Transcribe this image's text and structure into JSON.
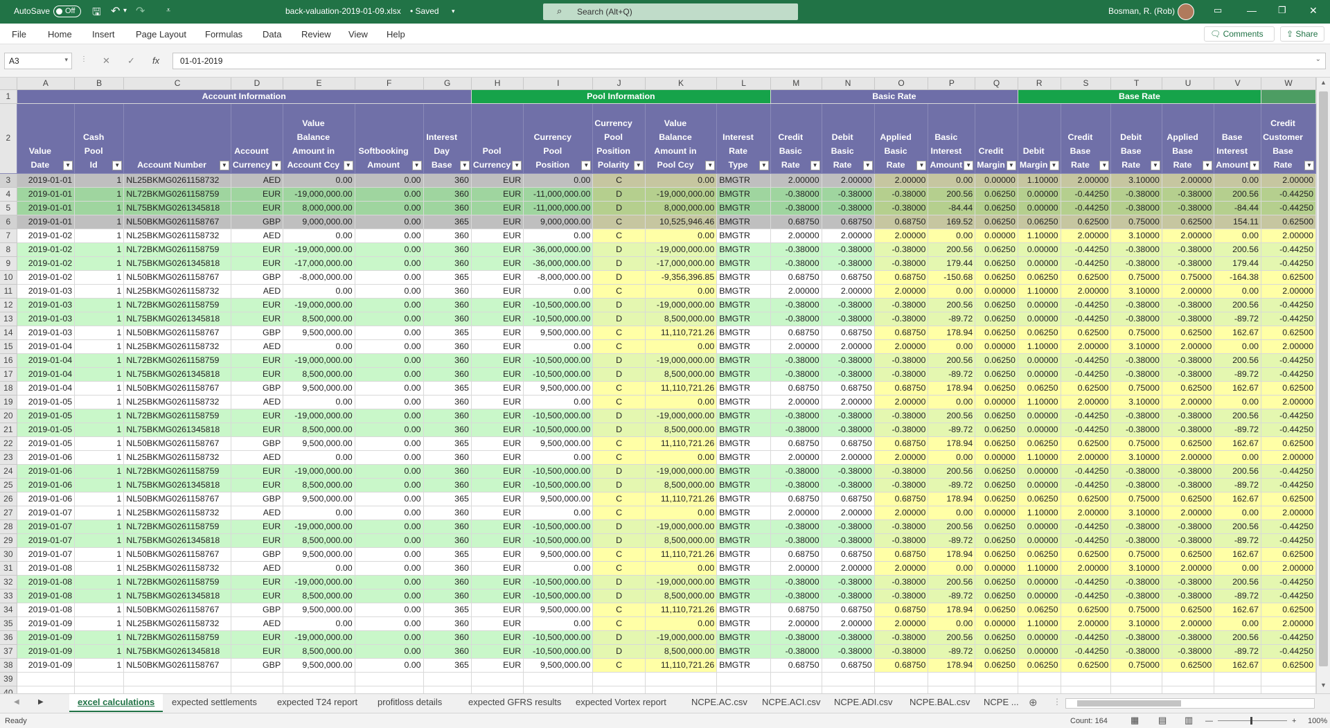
{
  "titlebar": {
    "autosave_label": "AutoSave",
    "autosave_state": "Off",
    "filename": "back-valuation-2019-01-09.xlsx",
    "saved_state": "• Saved",
    "search_placeholder": "Search (Alt+Q)",
    "user_name": "Bosman, R. (Rob)"
  },
  "menu": {
    "file": "File",
    "home": "Home",
    "insert": "Insert",
    "page_layout": "Page Layout",
    "formulas": "Formulas",
    "data": "Data",
    "review": "Review",
    "view": "View",
    "help": "Help",
    "comments": "Comments",
    "share": "Share"
  },
  "formula_bar": {
    "name_box": "A3",
    "fx": "fx",
    "value": "01-01-2019"
  },
  "columns": [
    "A",
    "B",
    "C",
    "D",
    "E",
    "F",
    "G",
    "H",
    "I",
    "J",
    "K",
    "L",
    "M",
    "N",
    "O",
    "P",
    "Q",
    "R",
    "S",
    "T",
    "U",
    "V",
    "W"
  ],
  "sections": [
    "Account Information",
    "Pool Information",
    "Basic Rate",
    "Base Rate"
  ],
  "headers": [
    "Value Date",
    "Cash Pool\nId",
    "Account Number",
    "Account\nCurrency",
    "Value Balance\nAmount in\nAccount Ccy",
    "Softbooking\nAmount",
    "Interest\nDay Base",
    "Pool\nCurrency",
    "Currency\nPool Position",
    "Currency\nPool\nPosition\nPolarity",
    "Value Balance\nAmount in\nPool Ccy",
    "Interest\nRate Type",
    "Credit\nBasic Rate",
    "Debit\nBasic Rate",
    "Applied\nBasic Rate",
    "Basic\nInterest\nAmount",
    "Credit\nMargin",
    "Debit\nMargin",
    "Credit\nBase Rate",
    "Debit\nBase Rate",
    "Applied\nBase Rate",
    "Base\nInterest\nAmount",
    "Credit\nCustomer\nBase Rate"
  ],
  "rows": [
    [
      "2019-01-01",
      "1",
      "NL25BKMG0261158732",
      "AED",
      "0.00",
      "0.00",
      "360",
      "EUR",
      "0.00",
      "C",
      "0.00",
      "BMGTR",
      "2.00000",
      "2.00000",
      "2.00000",
      "0.00",
      "0.00000",
      "1.10000",
      "2.00000",
      "3.10000",
      "2.00000",
      "0.00",
      "2.00000"
    ],
    [
      "2019-01-01",
      "1",
      "NL72BKMG0261158759",
      "EUR",
      "-19,000,000.00",
      "0.00",
      "360",
      "EUR",
      "-11,000,000.00",
      "D",
      "-19,000,000.00",
      "BMGTR",
      "-0.38000",
      "-0.38000",
      "-0.38000",
      "200.56",
      "0.06250",
      "0.00000",
      "-0.44250",
      "-0.38000",
      "-0.38000",
      "200.56",
      "-0.44250"
    ],
    [
      "2019-01-01",
      "1",
      "NL75BKMG0261345818",
      "EUR",
      "8,000,000.00",
      "0.00",
      "360",
      "EUR",
      "-11,000,000.00",
      "D",
      "8,000,000.00",
      "BMGTR",
      "-0.38000",
      "-0.38000",
      "-0.38000",
      "-84.44",
      "0.06250",
      "0.00000",
      "-0.44250",
      "-0.38000",
      "-0.38000",
      "-84.44",
      "-0.44250"
    ],
    [
      "2019-01-01",
      "1",
      "NL50BKMG0261158767",
      "GBP",
      "9,000,000.00",
      "0.00",
      "365",
      "EUR",
      "9,000,000.00",
      "C",
      "10,525,946.46",
      "BMGTR",
      "0.68750",
      "0.68750",
      "0.68750",
      "169.52",
      "0.06250",
      "0.06250",
      "0.62500",
      "0.75000",
      "0.62500",
      "154.11",
      "0.62500"
    ],
    [
      "2019-01-02",
      "1",
      "NL25BKMG0261158732",
      "AED",
      "0.00",
      "0.00",
      "360",
      "EUR",
      "0.00",
      "C",
      "0.00",
      "BMGTR",
      "2.00000",
      "2.00000",
      "2.00000",
      "0.00",
      "0.00000",
      "1.10000",
      "2.00000",
      "3.10000",
      "2.00000",
      "0.00",
      "2.00000"
    ],
    [
      "2019-01-02",
      "1",
      "NL72BKMG0261158759",
      "EUR",
      "-19,000,000.00",
      "0.00",
      "360",
      "EUR",
      "-36,000,000.00",
      "D",
      "-19,000,000.00",
      "BMGTR",
      "-0.38000",
      "-0.38000",
      "-0.38000",
      "200.56",
      "0.06250",
      "0.00000",
      "-0.44250",
      "-0.38000",
      "-0.38000",
      "200.56",
      "-0.44250"
    ],
    [
      "2019-01-02",
      "1",
      "NL75BKMG0261345818",
      "EUR",
      "-17,000,000.00",
      "0.00",
      "360",
      "EUR",
      "-36,000,000.00",
      "D",
      "-17,000,000.00",
      "BMGTR",
      "-0.38000",
      "-0.38000",
      "-0.38000",
      "179.44",
      "0.06250",
      "0.00000",
      "-0.44250",
      "-0.38000",
      "-0.38000",
      "179.44",
      "-0.44250"
    ],
    [
      "2019-01-02",
      "1",
      "NL50BKMG0261158767",
      "GBP",
      "-8,000,000.00",
      "0.00",
      "365",
      "EUR",
      "-8,000,000.00",
      "D",
      "-9,356,396.85",
      "BMGTR",
      "0.68750",
      "0.68750",
      "0.68750",
      "-150.68",
      "0.06250",
      "0.06250",
      "0.62500",
      "0.75000",
      "0.75000",
      "-164.38",
      "0.62500"
    ],
    [
      "2019-01-03",
      "1",
      "NL25BKMG0261158732",
      "AED",
      "0.00",
      "0.00",
      "360",
      "EUR",
      "0.00",
      "C",
      "0.00",
      "BMGTR",
      "2.00000",
      "2.00000",
      "2.00000",
      "0.00",
      "0.00000",
      "1.10000",
      "2.00000",
      "3.10000",
      "2.00000",
      "0.00",
      "2.00000"
    ],
    [
      "2019-01-03",
      "1",
      "NL72BKMG0261158759",
      "EUR",
      "-19,000,000.00",
      "0.00",
      "360",
      "EUR",
      "-10,500,000.00",
      "D",
      "-19,000,000.00",
      "BMGTR",
      "-0.38000",
      "-0.38000",
      "-0.38000",
      "200.56",
      "0.06250",
      "0.00000",
      "-0.44250",
      "-0.38000",
      "-0.38000",
      "200.56",
      "-0.44250"
    ],
    [
      "2019-01-03",
      "1",
      "NL75BKMG0261345818",
      "EUR",
      "8,500,000.00",
      "0.00",
      "360",
      "EUR",
      "-10,500,000.00",
      "D",
      "8,500,000.00",
      "BMGTR",
      "-0.38000",
      "-0.38000",
      "-0.38000",
      "-89.72",
      "0.06250",
      "0.00000",
      "-0.44250",
      "-0.38000",
      "-0.38000",
      "-89.72",
      "-0.44250"
    ],
    [
      "2019-01-03",
      "1",
      "NL50BKMG0261158767",
      "GBP",
      "9,500,000.00",
      "0.00",
      "365",
      "EUR",
      "9,500,000.00",
      "C",
      "11,110,721.26",
      "BMGTR",
      "0.68750",
      "0.68750",
      "0.68750",
      "178.94",
      "0.06250",
      "0.06250",
      "0.62500",
      "0.75000",
      "0.62500",
      "162.67",
      "0.62500"
    ],
    [
      "2019-01-04",
      "1",
      "NL25BKMG0261158732",
      "AED",
      "0.00",
      "0.00",
      "360",
      "EUR",
      "0.00",
      "C",
      "0.00",
      "BMGTR",
      "2.00000",
      "2.00000",
      "2.00000",
      "0.00",
      "0.00000",
      "1.10000",
      "2.00000",
      "3.10000",
      "2.00000",
      "0.00",
      "2.00000"
    ],
    [
      "2019-01-04",
      "1",
      "NL72BKMG0261158759",
      "EUR",
      "-19,000,000.00",
      "0.00",
      "360",
      "EUR",
      "-10,500,000.00",
      "D",
      "-19,000,000.00",
      "BMGTR",
      "-0.38000",
      "-0.38000",
      "-0.38000",
      "200.56",
      "0.06250",
      "0.00000",
      "-0.44250",
      "-0.38000",
      "-0.38000",
      "200.56",
      "-0.44250"
    ],
    [
      "2019-01-04",
      "1",
      "NL75BKMG0261345818",
      "EUR",
      "8,500,000.00",
      "0.00",
      "360",
      "EUR",
      "-10,500,000.00",
      "D",
      "8,500,000.00",
      "BMGTR",
      "-0.38000",
      "-0.38000",
      "-0.38000",
      "-89.72",
      "0.06250",
      "0.00000",
      "-0.44250",
      "-0.38000",
      "-0.38000",
      "-89.72",
      "-0.44250"
    ],
    [
      "2019-01-04",
      "1",
      "NL50BKMG0261158767",
      "GBP",
      "9,500,000.00",
      "0.00",
      "365",
      "EUR",
      "9,500,000.00",
      "C",
      "11,110,721.26",
      "BMGTR",
      "0.68750",
      "0.68750",
      "0.68750",
      "178.94",
      "0.06250",
      "0.06250",
      "0.62500",
      "0.75000",
      "0.62500",
      "162.67",
      "0.62500"
    ],
    [
      "2019-01-05",
      "1",
      "NL25BKMG0261158732",
      "AED",
      "0.00",
      "0.00",
      "360",
      "EUR",
      "0.00",
      "C",
      "0.00",
      "BMGTR",
      "2.00000",
      "2.00000",
      "2.00000",
      "0.00",
      "0.00000",
      "1.10000",
      "2.00000",
      "3.10000",
      "2.00000",
      "0.00",
      "2.00000"
    ],
    [
      "2019-01-05",
      "1",
      "NL72BKMG0261158759",
      "EUR",
      "-19,000,000.00",
      "0.00",
      "360",
      "EUR",
      "-10,500,000.00",
      "D",
      "-19,000,000.00",
      "BMGTR",
      "-0.38000",
      "-0.38000",
      "-0.38000",
      "200.56",
      "0.06250",
      "0.00000",
      "-0.44250",
      "-0.38000",
      "-0.38000",
      "200.56",
      "-0.44250"
    ],
    [
      "2019-01-05",
      "1",
      "NL75BKMG0261345818",
      "EUR",
      "8,500,000.00",
      "0.00",
      "360",
      "EUR",
      "-10,500,000.00",
      "D",
      "8,500,000.00",
      "BMGTR",
      "-0.38000",
      "-0.38000",
      "-0.38000",
      "-89.72",
      "0.06250",
      "0.00000",
      "-0.44250",
      "-0.38000",
      "-0.38000",
      "-89.72",
      "-0.44250"
    ],
    [
      "2019-01-05",
      "1",
      "NL50BKMG0261158767",
      "GBP",
      "9,500,000.00",
      "0.00",
      "365",
      "EUR",
      "9,500,000.00",
      "C",
      "11,110,721.26",
      "BMGTR",
      "0.68750",
      "0.68750",
      "0.68750",
      "178.94",
      "0.06250",
      "0.06250",
      "0.62500",
      "0.75000",
      "0.62500",
      "162.67",
      "0.62500"
    ],
    [
      "2019-01-06",
      "1",
      "NL25BKMG0261158732",
      "AED",
      "0.00",
      "0.00",
      "360",
      "EUR",
      "0.00",
      "C",
      "0.00",
      "BMGTR",
      "2.00000",
      "2.00000",
      "2.00000",
      "0.00",
      "0.00000",
      "1.10000",
      "2.00000",
      "3.10000",
      "2.00000",
      "0.00",
      "2.00000"
    ],
    [
      "2019-01-06",
      "1",
      "NL72BKMG0261158759",
      "EUR",
      "-19,000,000.00",
      "0.00",
      "360",
      "EUR",
      "-10,500,000.00",
      "D",
      "-19,000,000.00",
      "BMGTR",
      "-0.38000",
      "-0.38000",
      "-0.38000",
      "200.56",
      "0.06250",
      "0.00000",
      "-0.44250",
      "-0.38000",
      "-0.38000",
      "200.56",
      "-0.44250"
    ],
    [
      "2019-01-06",
      "1",
      "NL75BKMG0261345818",
      "EUR",
      "8,500,000.00",
      "0.00",
      "360",
      "EUR",
      "-10,500,000.00",
      "D",
      "8,500,000.00",
      "BMGTR",
      "-0.38000",
      "-0.38000",
      "-0.38000",
      "-89.72",
      "0.06250",
      "0.00000",
      "-0.44250",
      "-0.38000",
      "-0.38000",
      "-89.72",
      "-0.44250"
    ],
    [
      "2019-01-06",
      "1",
      "NL50BKMG0261158767",
      "GBP",
      "9,500,000.00",
      "0.00",
      "365",
      "EUR",
      "9,500,000.00",
      "C",
      "11,110,721.26",
      "BMGTR",
      "0.68750",
      "0.68750",
      "0.68750",
      "178.94",
      "0.06250",
      "0.06250",
      "0.62500",
      "0.75000",
      "0.62500",
      "162.67",
      "0.62500"
    ],
    [
      "2019-01-07",
      "1",
      "NL25BKMG0261158732",
      "AED",
      "0.00",
      "0.00",
      "360",
      "EUR",
      "0.00",
      "C",
      "0.00",
      "BMGTR",
      "2.00000",
      "2.00000",
      "2.00000",
      "0.00",
      "0.00000",
      "1.10000",
      "2.00000",
      "3.10000",
      "2.00000",
      "0.00",
      "2.00000"
    ],
    [
      "2019-01-07",
      "1",
      "NL72BKMG0261158759",
      "EUR",
      "-19,000,000.00",
      "0.00",
      "360",
      "EUR",
      "-10,500,000.00",
      "D",
      "-19,000,000.00",
      "BMGTR",
      "-0.38000",
      "-0.38000",
      "-0.38000",
      "200.56",
      "0.06250",
      "0.00000",
      "-0.44250",
      "-0.38000",
      "-0.38000",
      "200.56",
      "-0.44250"
    ],
    [
      "2019-01-07",
      "1",
      "NL75BKMG0261345818",
      "EUR",
      "8,500,000.00",
      "0.00",
      "360",
      "EUR",
      "-10,500,000.00",
      "D",
      "8,500,000.00",
      "BMGTR",
      "-0.38000",
      "-0.38000",
      "-0.38000",
      "-89.72",
      "0.06250",
      "0.00000",
      "-0.44250",
      "-0.38000",
      "-0.38000",
      "-89.72",
      "-0.44250"
    ],
    [
      "2019-01-07",
      "1",
      "NL50BKMG0261158767",
      "GBP",
      "9,500,000.00",
      "0.00",
      "365",
      "EUR",
      "9,500,000.00",
      "C",
      "11,110,721.26",
      "BMGTR",
      "0.68750",
      "0.68750",
      "0.68750",
      "178.94",
      "0.06250",
      "0.06250",
      "0.62500",
      "0.75000",
      "0.62500",
      "162.67",
      "0.62500"
    ],
    [
      "2019-01-08",
      "1",
      "NL25BKMG0261158732",
      "AED",
      "0.00",
      "0.00",
      "360",
      "EUR",
      "0.00",
      "C",
      "0.00",
      "BMGTR",
      "2.00000",
      "2.00000",
      "2.00000",
      "0.00",
      "0.00000",
      "1.10000",
      "2.00000",
      "3.10000",
      "2.00000",
      "0.00",
      "2.00000"
    ],
    [
      "2019-01-08",
      "1",
      "NL72BKMG0261158759",
      "EUR",
      "-19,000,000.00",
      "0.00",
      "360",
      "EUR",
      "-10,500,000.00",
      "D",
      "-19,000,000.00",
      "BMGTR",
      "-0.38000",
      "-0.38000",
      "-0.38000",
      "200.56",
      "0.06250",
      "0.00000",
      "-0.44250",
      "-0.38000",
      "-0.38000",
      "200.56",
      "-0.44250"
    ],
    [
      "2019-01-08",
      "1",
      "NL75BKMG0261345818",
      "EUR",
      "8,500,000.00",
      "0.00",
      "360",
      "EUR",
      "-10,500,000.00",
      "D",
      "8,500,000.00",
      "BMGTR",
      "-0.38000",
      "-0.38000",
      "-0.38000",
      "-89.72",
      "0.06250",
      "0.00000",
      "-0.44250",
      "-0.38000",
      "-0.38000",
      "-89.72",
      "-0.44250"
    ],
    [
      "2019-01-08",
      "1",
      "NL50BKMG0261158767",
      "GBP",
      "9,500,000.00",
      "0.00",
      "365",
      "EUR",
      "9,500,000.00",
      "C",
      "11,110,721.26",
      "BMGTR",
      "0.68750",
      "0.68750",
      "0.68750",
      "178.94",
      "0.06250",
      "0.06250",
      "0.62500",
      "0.75000",
      "0.62500",
      "162.67",
      "0.62500"
    ],
    [
      "2019-01-09",
      "1",
      "NL25BKMG0261158732",
      "AED",
      "0.00",
      "0.00",
      "360",
      "EUR",
      "0.00",
      "C",
      "0.00",
      "BMGTR",
      "2.00000",
      "2.00000",
      "2.00000",
      "0.00",
      "0.00000",
      "1.10000",
      "2.00000",
      "3.10000",
      "2.00000",
      "0.00",
      "2.00000"
    ],
    [
      "2019-01-09",
      "1",
      "NL72BKMG0261158759",
      "EUR",
      "-19,000,000.00",
      "0.00",
      "360",
      "EUR",
      "-10,500,000.00",
      "D",
      "-19,000,000.00",
      "BMGTR",
      "-0.38000",
      "-0.38000",
      "-0.38000",
      "200.56",
      "0.06250",
      "0.00000",
      "-0.44250",
      "-0.38000",
      "-0.38000",
      "200.56",
      "-0.44250"
    ],
    [
      "2019-01-09",
      "1",
      "NL75BKMG0261345818",
      "EUR",
      "8,500,000.00",
      "0.00",
      "360",
      "EUR",
      "-10,500,000.00",
      "D",
      "8,500,000.00",
      "BMGTR",
      "-0.38000",
      "-0.38000",
      "-0.38000",
      "-89.72",
      "0.06250",
      "0.00000",
      "-0.44250",
      "-0.38000",
      "-0.38000",
      "-89.72",
      "-0.44250"
    ],
    [
      "2019-01-09",
      "1",
      "NL50BKMG0261158767",
      "GBP",
      "9,500,000.00",
      "0.00",
      "365",
      "EUR",
      "9,500,000.00",
      "C",
      "11,110,721.26",
      "BMGTR",
      "0.68750",
      "0.68750",
      "0.68750",
      "178.94",
      "0.06250",
      "0.06250",
      "0.62500",
      "0.75000",
      "0.62500",
      "162.67",
      "0.62500"
    ]
  ],
  "empty_row_numbers": [
    "39",
    "40"
  ],
  "sheet_tabs": [
    "excel calculations",
    "expected settlements",
    "expected T24 report",
    "profitloss details",
    "expected GFRS results",
    "expected Vortex report",
    "NCPE.AC.csv",
    "NCPE.ACI.csv",
    "NCPE.ADI.csv",
    "NCPE.BAL.csv",
    "NCPE ..."
  ],
  "status": {
    "ready": "Ready",
    "count": "Count: 164",
    "zoom": "100%"
  },
  "icons": {
    "save": "save-icon",
    "undo": "undo-icon",
    "redo": "redo-icon",
    "search": "search-icon",
    "avatar": "user-avatar",
    "add_sheet": "plus-icon"
  },
  "colors": {
    "excel_green": "#217346",
    "header_purple": "#7070a8",
    "section_green": "#16a34a",
    "row_eur": "#c9f7c9",
    "col_yellow": "#ffffa6",
    "selection_gray": "#bfbfbf"
  }
}
